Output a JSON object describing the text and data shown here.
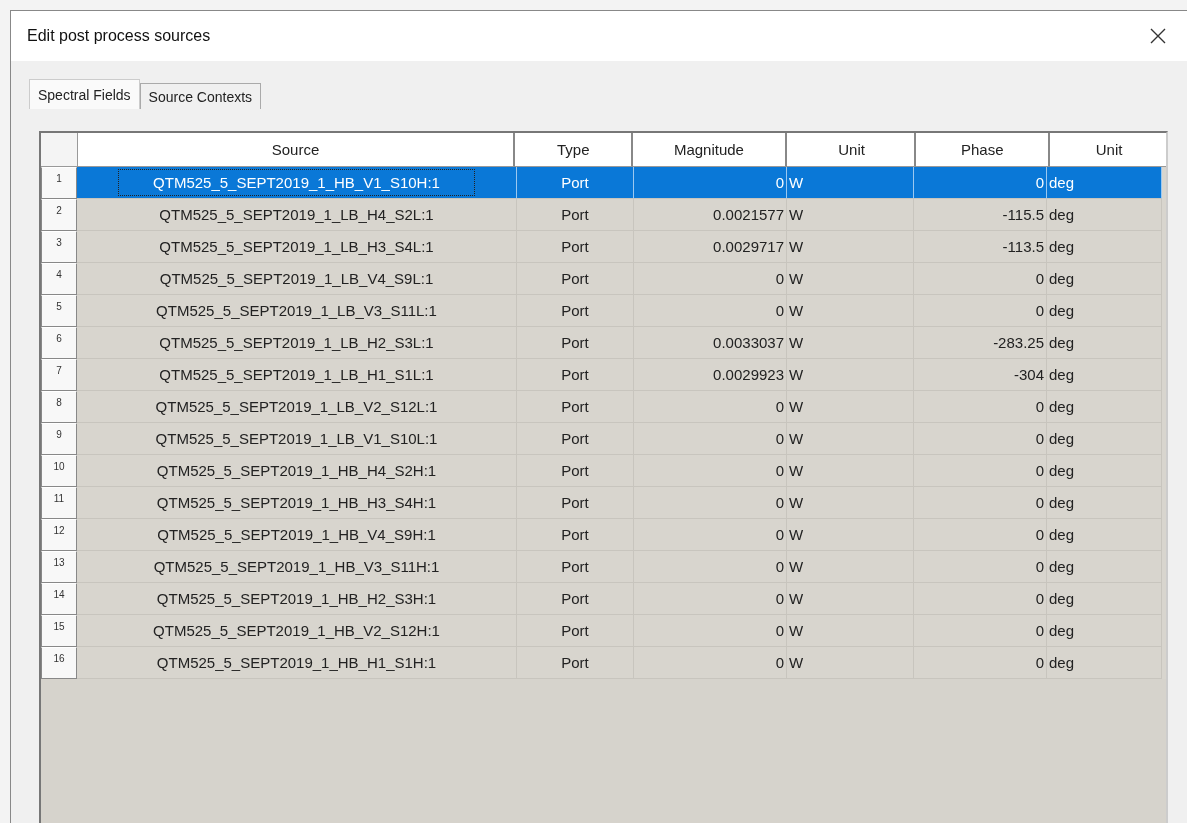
{
  "window": {
    "title": "Edit post process sources"
  },
  "tabs": [
    {
      "label": "Spectral Fields",
      "selected": true
    },
    {
      "label": "Source Contexts",
      "selected": false
    }
  ],
  "table": {
    "columns": [
      "Source",
      "Type",
      "Magnitude",
      "Unit",
      "Phase",
      "Unit"
    ],
    "rows": [
      {
        "number": "1",
        "source": "QTM525_5_SEPT2019_1_HB_V1_S10H:1",
        "type": "Port",
        "magnitude": "0",
        "magnitude_unit": "W",
        "phase": "0",
        "phase_unit": "deg",
        "selected": true
      },
      {
        "number": "2",
        "source": "QTM525_5_SEPT2019_1_LB_H4_S2L:1",
        "type": "Port",
        "magnitude": "0.0021577",
        "magnitude_unit": "W",
        "phase": "-115.5",
        "phase_unit": "deg",
        "selected": false
      },
      {
        "number": "3",
        "source": "QTM525_5_SEPT2019_1_LB_H3_S4L:1",
        "type": "Port",
        "magnitude": "0.0029717",
        "magnitude_unit": "W",
        "phase": "-113.5",
        "phase_unit": "deg",
        "selected": false
      },
      {
        "number": "4",
        "source": "QTM525_5_SEPT2019_1_LB_V4_S9L:1",
        "type": "Port",
        "magnitude": "0",
        "magnitude_unit": "W",
        "phase": "0",
        "phase_unit": "deg",
        "selected": false
      },
      {
        "number": "5",
        "source": "QTM525_5_SEPT2019_1_LB_V3_S11L:1",
        "type": "Port",
        "magnitude": "0",
        "magnitude_unit": "W",
        "phase": "0",
        "phase_unit": "deg",
        "selected": false
      },
      {
        "number": "6",
        "source": "QTM525_5_SEPT2019_1_LB_H2_S3L:1",
        "type": "Port",
        "magnitude": "0.0033037",
        "magnitude_unit": "W",
        "phase": "-283.25",
        "phase_unit": "deg",
        "selected": false
      },
      {
        "number": "7",
        "source": "QTM525_5_SEPT2019_1_LB_H1_S1L:1",
        "type": "Port",
        "magnitude": "0.0029923",
        "magnitude_unit": "W",
        "phase": "-304",
        "phase_unit": "deg",
        "selected": false
      },
      {
        "number": "8",
        "source": "QTM525_5_SEPT2019_1_LB_V2_S12L:1",
        "type": "Port",
        "magnitude": "0",
        "magnitude_unit": "W",
        "phase": "0",
        "phase_unit": "deg",
        "selected": false
      },
      {
        "number": "9",
        "source": "QTM525_5_SEPT2019_1_LB_V1_S10L:1",
        "type": "Port",
        "magnitude": "0",
        "magnitude_unit": "W",
        "phase": "0",
        "phase_unit": "deg",
        "selected": false
      },
      {
        "number": "10",
        "source": "QTM525_5_SEPT2019_1_HB_H4_S2H:1",
        "type": "Port",
        "magnitude": "0",
        "magnitude_unit": "W",
        "phase": "0",
        "phase_unit": "deg",
        "selected": false
      },
      {
        "number": "11",
        "source": "QTM525_5_SEPT2019_1_HB_H3_S4H:1",
        "type": "Port",
        "magnitude": "0",
        "magnitude_unit": "W",
        "phase": "0",
        "phase_unit": "deg",
        "selected": false
      },
      {
        "number": "12",
        "source": "QTM525_5_SEPT2019_1_HB_V4_S9H:1",
        "type": "Port",
        "magnitude": "0",
        "magnitude_unit": "W",
        "phase": "0",
        "phase_unit": "deg",
        "selected": false
      },
      {
        "number": "13",
        "source": "QTM525_5_SEPT2019_1_HB_V3_S11H:1",
        "type": "Port",
        "magnitude": "0",
        "magnitude_unit": "W",
        "phase": "0",
        "phase_unit": "deg",
        "selected": false
      },
      {
        "number": "14",
        "source": "QTM525_5_SEPT2019_1_HB_H2_S3H:1",
        "type": "Port",
        "magnitude": "0",
        "magnitude_unit": "W",
        "phase": "0",
        "phase_unit": "deg",
        "selected": false
      },
      {
        "number": "15",
        "source": "QTM525_5_SEPT2019_1_HB_V2_S12H:1",
        "type": "Port",
        "magnitude": "0",
        "magnitude_unit": "W",
        "phase": "0",
        "phase_unit": "deg",
        "selected": false
      },
      {
        "number": "16",
        "source": "QTM525_5_SEPT2019_1_HB_H1_S1H:1",
        "type": "Port",
        "magnitude": "0",
        "magnitude_unit": "W",
        "phase": "0",
        "phase_unit": "deg",
        "selected": false
      }
    ]
  }
}
